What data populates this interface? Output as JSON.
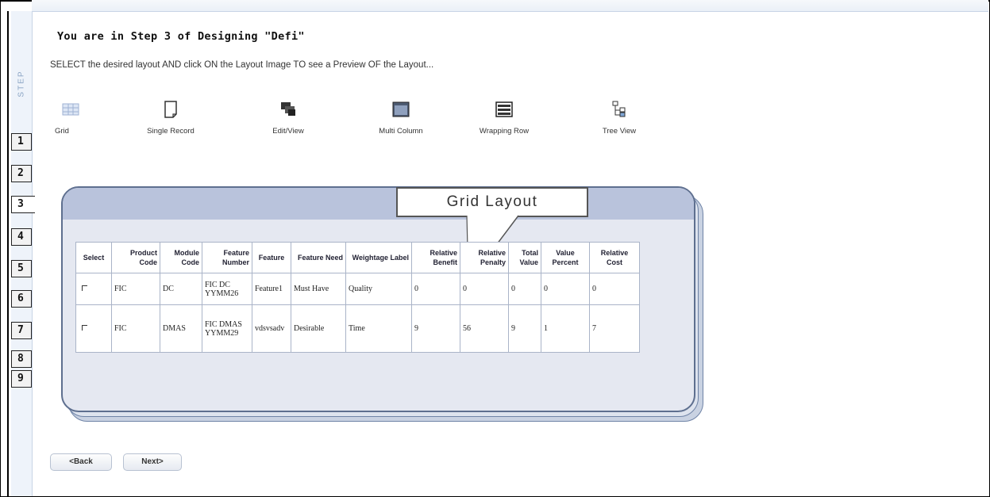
{
  "header": {
    "title": "You are in Step 3 of Designing \"Defi\"",
    "instruction": "SELECT the desired layout AND click ON the Layout Image TO see a Preview OF the Layout..."
  },
  "steps": {
    "label": "STEP",
    "items": [
      "1",
      "2",
      "3",
      "4",
      "5",
      "6",
      "7",
      "8",
      "9"
    ],
    "active": "3"
  },
  "layouts": [
    {
      "label": "Grid",
      "icon": "grid-layout-icon"
    },
    {
      "label": "Single Record",
      "icon": "single-record-icon"
    },
    {
      "label": "Edit/View",
      "icon": "edit-view-icon"
    },
    {
      "label": "Multi Column",
      "icon": "multi-column-icon"
    },
    {
      "label": "Wrapping Row",
      "icon": "wrapping-row-icon"
    },
    {
      "label": "Tree View",
      "icon": "tree-view-icon"
    }
  ],
  "preview": {
    "callout": "Grid Layout",
    "columns": [
      "Select",
      "Product Code",
      "Module Code",
      "Feature Number",
      "Feature",
      "Feature Need",
      "Weightage Label",
      "Relative Benefit",
      "Relative Penalty",
      "Total Value",
      "Value Percent",
      "Relative Cost"
    ],
    "rows": [
      [
        "",
        "FIC",
        "DC",
        "FIC DC YYMM26",
        "Feature1",
        "Must Have",
        "Quality",
        "0",
        "0",
        "0",
        "0",
        "0"
      ],
      [
        "",
        "FIC",
        "DMAS",
        "FIC DMAS YYMM29",
        "vdsvsadv",
        "Desirable",
        "Time",
        "9",
        "56",
        "9",
        "1",
        "7"
      ]
    ]
  },
  "buttons": {
    "back": "<Back",
    "next": "Next>"
  },
  "colors": {
    "step_active_bg": "#ffffff",
    "preview_panel": "#e5e8f1",
    "preview_header": "#b9c3dc"
  }
}
